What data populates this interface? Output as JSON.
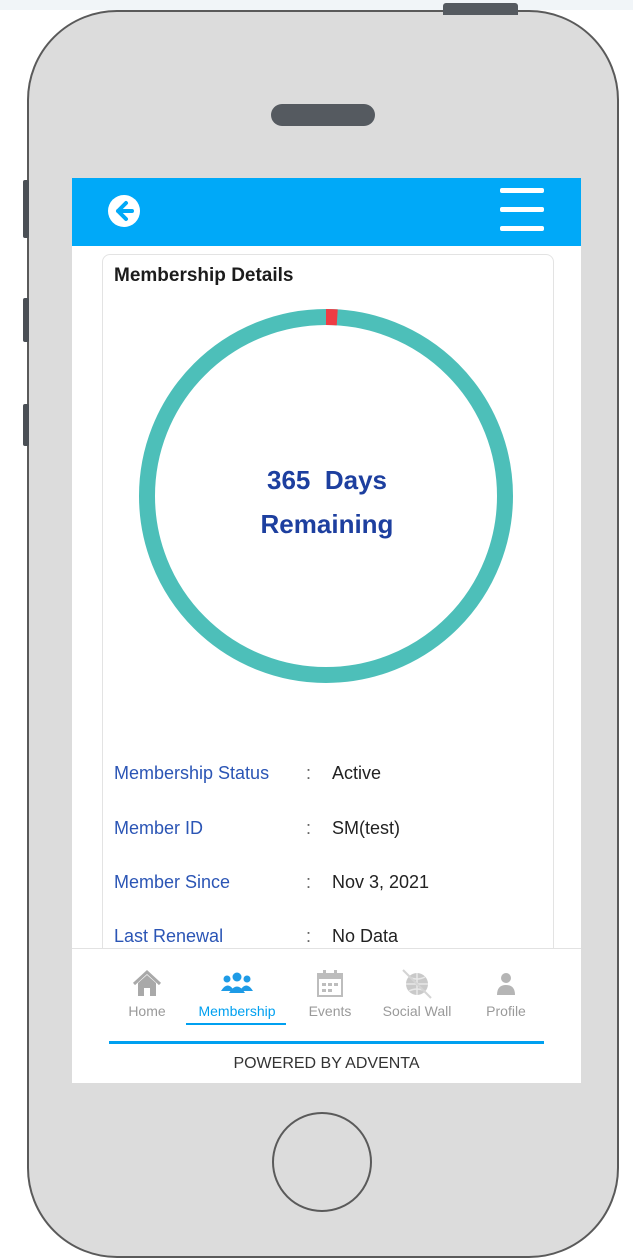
{
  "card": {
    "title": "Membership Details"
  },
  "progress": {
    "days_number": "365",
    "days_word": "Days",
    "remaining_label": "Remaining",
    "elapsed_fraction": 0.01
  },
  "details": [
    {
      "label": "Membership Status",
      "colon": ":",
      "value": "Active"
    },
    {
      "label": "Member ID",
      "colon": ":",
      "value": "SM(test)"
    },
    {
      "label": "Member Since",
      "colon": ":",
      "value": "Nov 3, 2021"
    },
    {
      "label": "Last Renewal",
      "colon": ":",
      "value": "No Data"
    }
  ],
  "nav": {
    "items": [
      {
        "label": "Home",
        "icon": "home-icon"
      },
      {
        "label": "Membership",
        "icon": "group-icon"
      },
      {
        "label": "Events",
        "icon": "calendar-icon"
      },
      {
        "label": "Social Wall",
        "icon": "globe-icon"
      },
      {
        "label": "Profile",
        "icon": "user-icon"
      }
    ],
    "active": "Membership"
  },
  "footer": {
    "powered_by": "POWERED BY ADVENTA"
  },
  "colors": {
    "appbar": "#00a9f8",
    "ring": "#4dbfb9",
    "ring_elapsed": "#ee3d44",
    "days_text": "#1d3f9f",
    "label_text": "#2b55b5",
    "nav_active": "#00a0f0"
  }
}
